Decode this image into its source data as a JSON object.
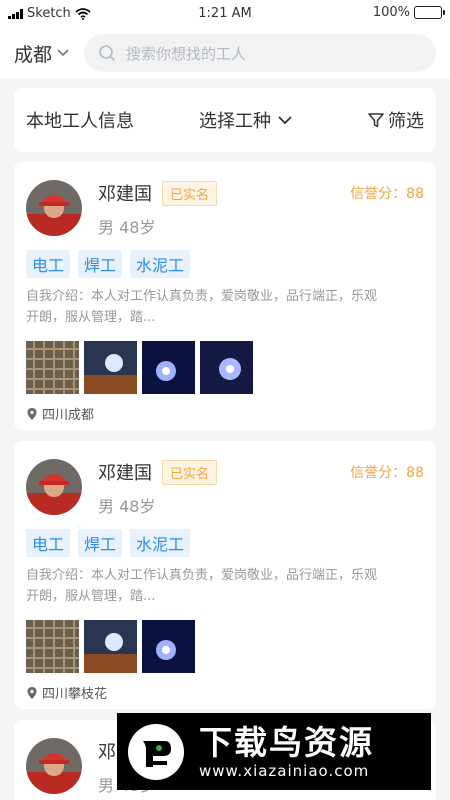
{
  "status": {
    "carrier": "Sketch",
    "time": "1:21 AM",
    "battery": "100%",
    "battery_level": 1.0
  },
  "header": {
    "city": "成都",
    "search_placeholder": "搜索你想找的工人"
  },
  "filter": {
    "title": "本地工人信息",
    "type_select": "选择工种",
    "filter_label": "筛选"
  },
  "workers": [
    {
      "name": "邓建国",
      "verified": "已实名",
      "credit": "信誉分：88",
      "gender_age": "男  48岁",
      "tags": [
        "电工",
        "焊工",
        "水泥工"
      ],
      "intro_line1": "自我介绍：本人对工作认真负责，爱岗敬业，品行端正，乐观",
      "intro_line2": "开朗，服从管理，踏...",
      "location": "四川成都"
    },
    {
      "name": "邓建国",
      "verified": "已实名",
      "credit": "信誉分：88",
      "gender_age": "男  48岁",
      "tags": [
        "电工",
        "焊工",
        "水泥工"
      ],
      "intro_line1": "自我介绍：本人对工作认真负责，爱岗敬业，品行端正，乐观",
      "intro_line2": "开朗，服从管理，踏...",
      "location": "四川攀枝花"
    },
    {
      "name": "邓建国",
      "gender_age": "男  48岁"
    }
  ],
  "watermark": {
    "title": "下载鸟资源",
    "url": "www.xiazainiao.com"
  }
}
